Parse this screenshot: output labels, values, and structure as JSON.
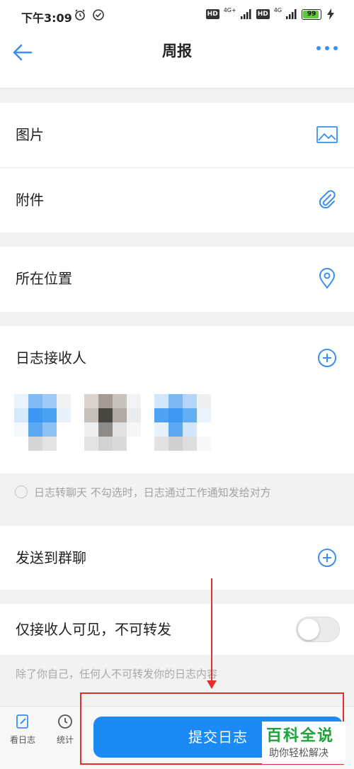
{
  "status_bar": {
    "time": "下午3:09",
    "hd_1": "HD",
    "net_1": "4G+",
    "hd_2": "HD",
    "net_2": "4G",
    "battery": "99",
    "battery_level": 0.99
  },
  "nav": {
    "title": "周报",
    "accent_color": "#3a8ff0"
  },
  "rows": {
    "image_label": "图片",
    "attachment_label": "附件",
    "location_label": "所在位置",
    "recipients_label": "日志接收人",
    "send_group_label": "发送到群聊",
    "private_label": "仅接收人可见，不可转发"
  },
  "hint": {
    "text": "日志转聊天 不勾选时，日志通过工作通知发给对方"
  },
  "privacy_note": "除了你自己，任何人不可转发你的日志内容",
  "toggle_on": false,
  "bottom": {
    "tab_view": "看日志",
    "tab_stats": "统计",
    "submit": "提交日志",
    "submit_color": "#1c8af5"
  },
  "watermark": {
    "title": "百科全说",
    "subtitle": "助你轻松解决"
  }
}
